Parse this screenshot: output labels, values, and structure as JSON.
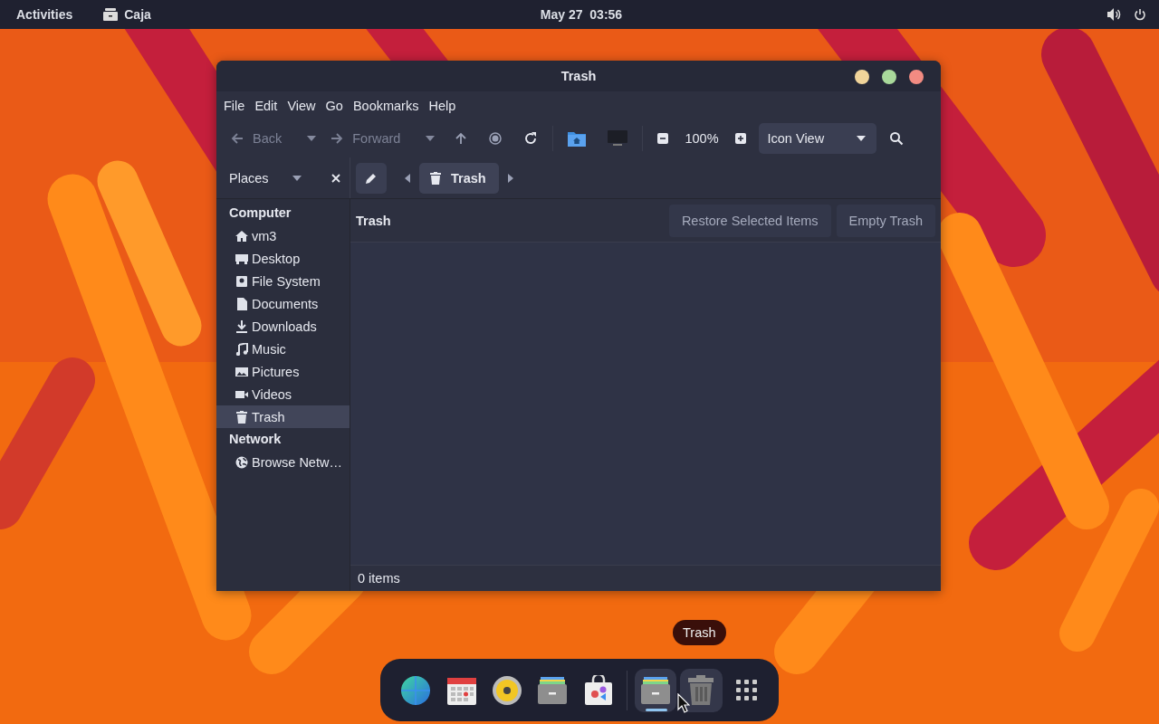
{
  "top_bar": {
    "activities": "Activities",
    "app_name": "Caja",
    "clock": "May 27  03:56"
  },
  "window": {
    "title": "Trash"
  },
  "menu": [
    "File",
    "Edit",
    "View",
    "Go",
    "Bookmarks",
    "Help"
  ],
  "toolbar": {
    "back": {
      "label": "Back",
      "disabled": true
    },
    "forward": {
      "label": "Forward",
      "disabled": true
    },
    "zoom": "100%",
    "view_mode": "Icon View"
  },
  "location": {
    "pane": "Places",
    "crumb": "Trash"
  },
  "sidebar": [
    {
      "heading": "Computer",
      "items": [
        {
          "label": "vm3",
          "kind": "home",
          "selected": false
        },
        {
          "label": "Desktop",
          "kind": "desktop",
          "selected": false
        },
        {
          "label": "File System",
          "kind": "disk",
          "selected": false
        },
        {
          "label": "Documents",
          "kind": "document",
          "selected": false
        },
        {
          "label": "Downloads",
          "kind": "download",
          "selected": false
        },
        {
          "label": "Music",
          "kind": "music",
          "selected": false
        },
        {
          "label": "Pictures",
          "kind": "pictures",
          "selected": false
        },
        {
          "label": "Videos",
          "kind": "video",
          "selected": false
        },
        {
          "label": "Trash",
          "kind": "trash",
          "selected": true
        }
      ]
    },
    {
      "heading": "Network",
      "items": [
        {
          "label": "Browse Netw…",
          "kind": "network",
          "selected": false
        }
      ]
    }
  ],
  "content": {
    "title": "Trash",
    "actions": [
      "Restore Selected Items",
      "Empty Trash"
    ]
  },
  "status": "0 items",
  "tooltip": "Trash",
  "dock": [
    {
      "kind": "browser",
      "running": false,
      "highlighted": false
    },
    {
      "kind": "calendar",
      "running": false,
      "highlighted": false
    },
    {
      "kind": "speaker",
      "running": false,
      "highlighted": false
    },
    {
      "kind": "cabinet",
      "running": false,
      "highlighted": false
    },
    {
      "kind": "store",
      "running": false,
      "highlighted": false
    },
    {
      "kind": "separator"
    },
    {
      "kind": "cabinet",
      "running": true,
      "highlighted": true
    },
    {
      "kind": "trash",
      "running": false,
      "highlighted": true
    },
    {
      "kind": "grid",
      "running": false,
      "highlighted": false
    }
  ]
}
